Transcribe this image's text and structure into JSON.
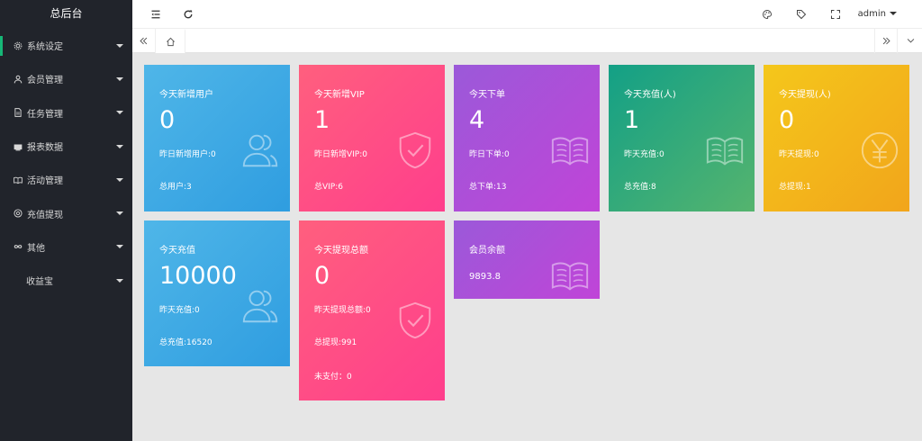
{
  "sidebar": {
    "logo": "总后台",
    "items": [
      {
        "label": "系统设定",
        "icon": "gear-icon"
      },
      {
        "label": "会员管理",
        "icon": "user-icon"
      },
      {
        "label": "任务管理",
        "icon": "document-icon"
      },
      {
        "label": "报表数据",
        "icon": "chart-icon"
      },
      {
        "label": "活动管理",
        "icon": "book-icon"
      },
      {
        "label": "充值提现",
        "icon": "circle-icon"
      },
      {
        "label": "其他",
        "icon": "infinity-icon"
      },
      {
        "label": "收益宝",
        "icon": ""
      }
    ]
  },
  "header": {
    "user": "admin",
    "icons": [
      "menu-collapse-icon",
      "refresh-icon",
      "palette-icon",
      "tag-icon",
      "fullscreen-icon"
    ]
  },
  "tabbar": {
    "icons": [
      "double-left-icon",
      "home-icon",
      "double-right-icon",
      "chevron-down-icon"
    ]
  },
  "cards": [
    {
      "title": "今天新增用户",
      "value": "0",
      "line1": "昨日新增用户:0",
      "line2": "总用户:3",
      "icon": "users-icon",
      "color": "blue"
    },
    {
      "title": "今天新增VIP",
      "value": "1",
      "line1": "昨日新增VIP:0",
      "line2": "总VIP:6",
      "icon": "shield-check-icon",
      "color": "pink"
    },
    {
      "title": "今天下单",
      "value": "4",
      "line1": "昨日下单:0",
      "line2": "总下单:13",
      "icon": "open-book-icon",
      "color": "purple"
    },
    {
      "title": "今天充值(人)",
      "value": "1",
      "line1": "昨天充值:0",
      "line2": "总充值:8",
      "icon": "open-book-icon",
      "color": "green"
    },
    {
      "title": "今天提现(人)",
      "value": "0",
      "line1": "昨天提现:0",
      "line2": "总提现:1",
      "icon": "yen-icon",
      "color": "yellow"
    },
    {
      "title": "今天充值",
      "value": "10000",
      "line1": "昨天充值:0",
      "line2": "总充值:16520",
      "icon": "users-icon",
      "color": "blue"
    },
    {
      "title": "今天提现总额",
      "value": "0",
      "line1": "昨天提现总额:0",
      "line2": "总提现:991",
      "line3": "未支付：0",
      "icon": "shield-check-icon",
      "color": "pink"
    },
    {
      "title": "会员余额",
      "value": "9893.8",
      "icon": "open-book-icon",
      "color": "purple"
    }
  ],
  "colors": {
    "sidebar_bg": "#21242b",
    "active_indicator": "#16b777",
    "blue": "#3aa7e4",
    "pink": "#ff4f84",
    "purple": "#ad4fd9",
    "green": "#2aa97c",
    "yellow": "#f3b71b"
  }
}
